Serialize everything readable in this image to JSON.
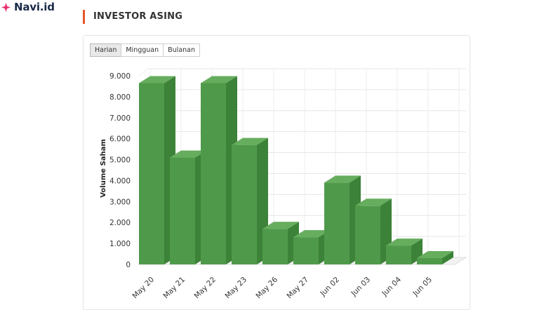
{
  "brand": {
    "name": "Navi.id",
    "icon": "sparkle-icon",
    "color": "#e8336d"
  },
  "section": {
    "title": "INVESTOR ASING",
    "accent": "#e8552b"
  },
  "tabs": [
    {
      "label": "Harian",
      "active": true
    },
    {
      "label": "Mingguan",
      "active": false
    },
    {
      "label": "Bulanan",
      "active": false
    }
  ],
  "chart_data": {
    "type": "bar",
    "style": "3d",
    "color": "#4f9a4a",
    "ylabel": "Volume Saham",
    "xlabel": "",
    "ylim": [
      0,
      9000
    ],
    "yticks": [
      "0",
      "1.000",
      "2.000",
      "3.000",
      "4.000",
      "5.000",
      "6.000",
      "7.000",
      "8.000",
      "9.000"
    ],
    "categories": [
      "May 20",
      "May 21",
      "May 22",
      "May 23",
      "May 26",
      "May 27",
      "Jun 02",
      "Jun 03",
      "Jun 04",
      "Jun 05"
    ],
    "values": [
      8650,
      5100,
      8650,
      5700,
      1700,
      1300,
      3900,
      2800,
      900,
      300
    ],
    "grid": true,
    "legend": false
  }
}
